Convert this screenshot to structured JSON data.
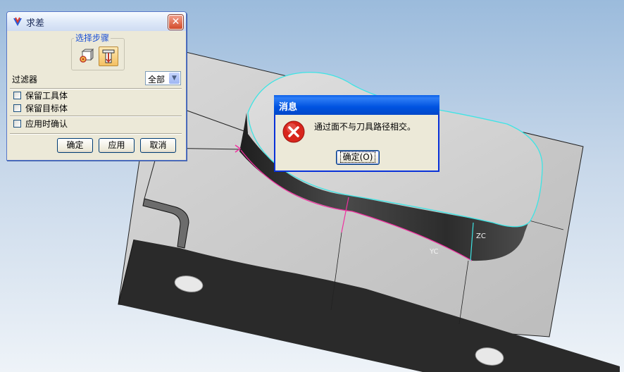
{
  "viewport": {
    "axis_labels": [
      "ZC",
      "YC"
    ]
  },
  "subtract_dialog": {
    "title": "求差",
    "close_symbol": "✕",
    "step_group_label": "选择步骤",
    "step_buttons": [
      {
        "icon": "select-target-body-icon"
      },
      {
        "icon": "select-tool-body-icon",
        "selected": true
      }
    ],
    "filter_label": "过滤器",
    "filter_value": "全部",
    "checkboxes": [
      {
        "label": "保留工具体",
        "checked": false
      },
      {
        "label": "保留目标体",
        "checked": false
      },
      {
        "label": "应用时确认",
        "checked": false
      }
    ],
    "buttons": {
      "ok": "确定",
      "apply": "应用",
      "cancel": "取消"
    }
  },
  "message_dialog": {
    "title": "消息",
    "icon": "error-icon",
    "text": "通过面不与刀具路径相交。",
    "ok_button": "确定(O)"
  },
  "colors": {
    "title_bar_blue": "#0053e1",
    "error_red": "#d8261c",
    "edge_highlight_cyan": "#3ee4e4",
    "edge_highlight_magenta": "#f030a0"
  }
}
